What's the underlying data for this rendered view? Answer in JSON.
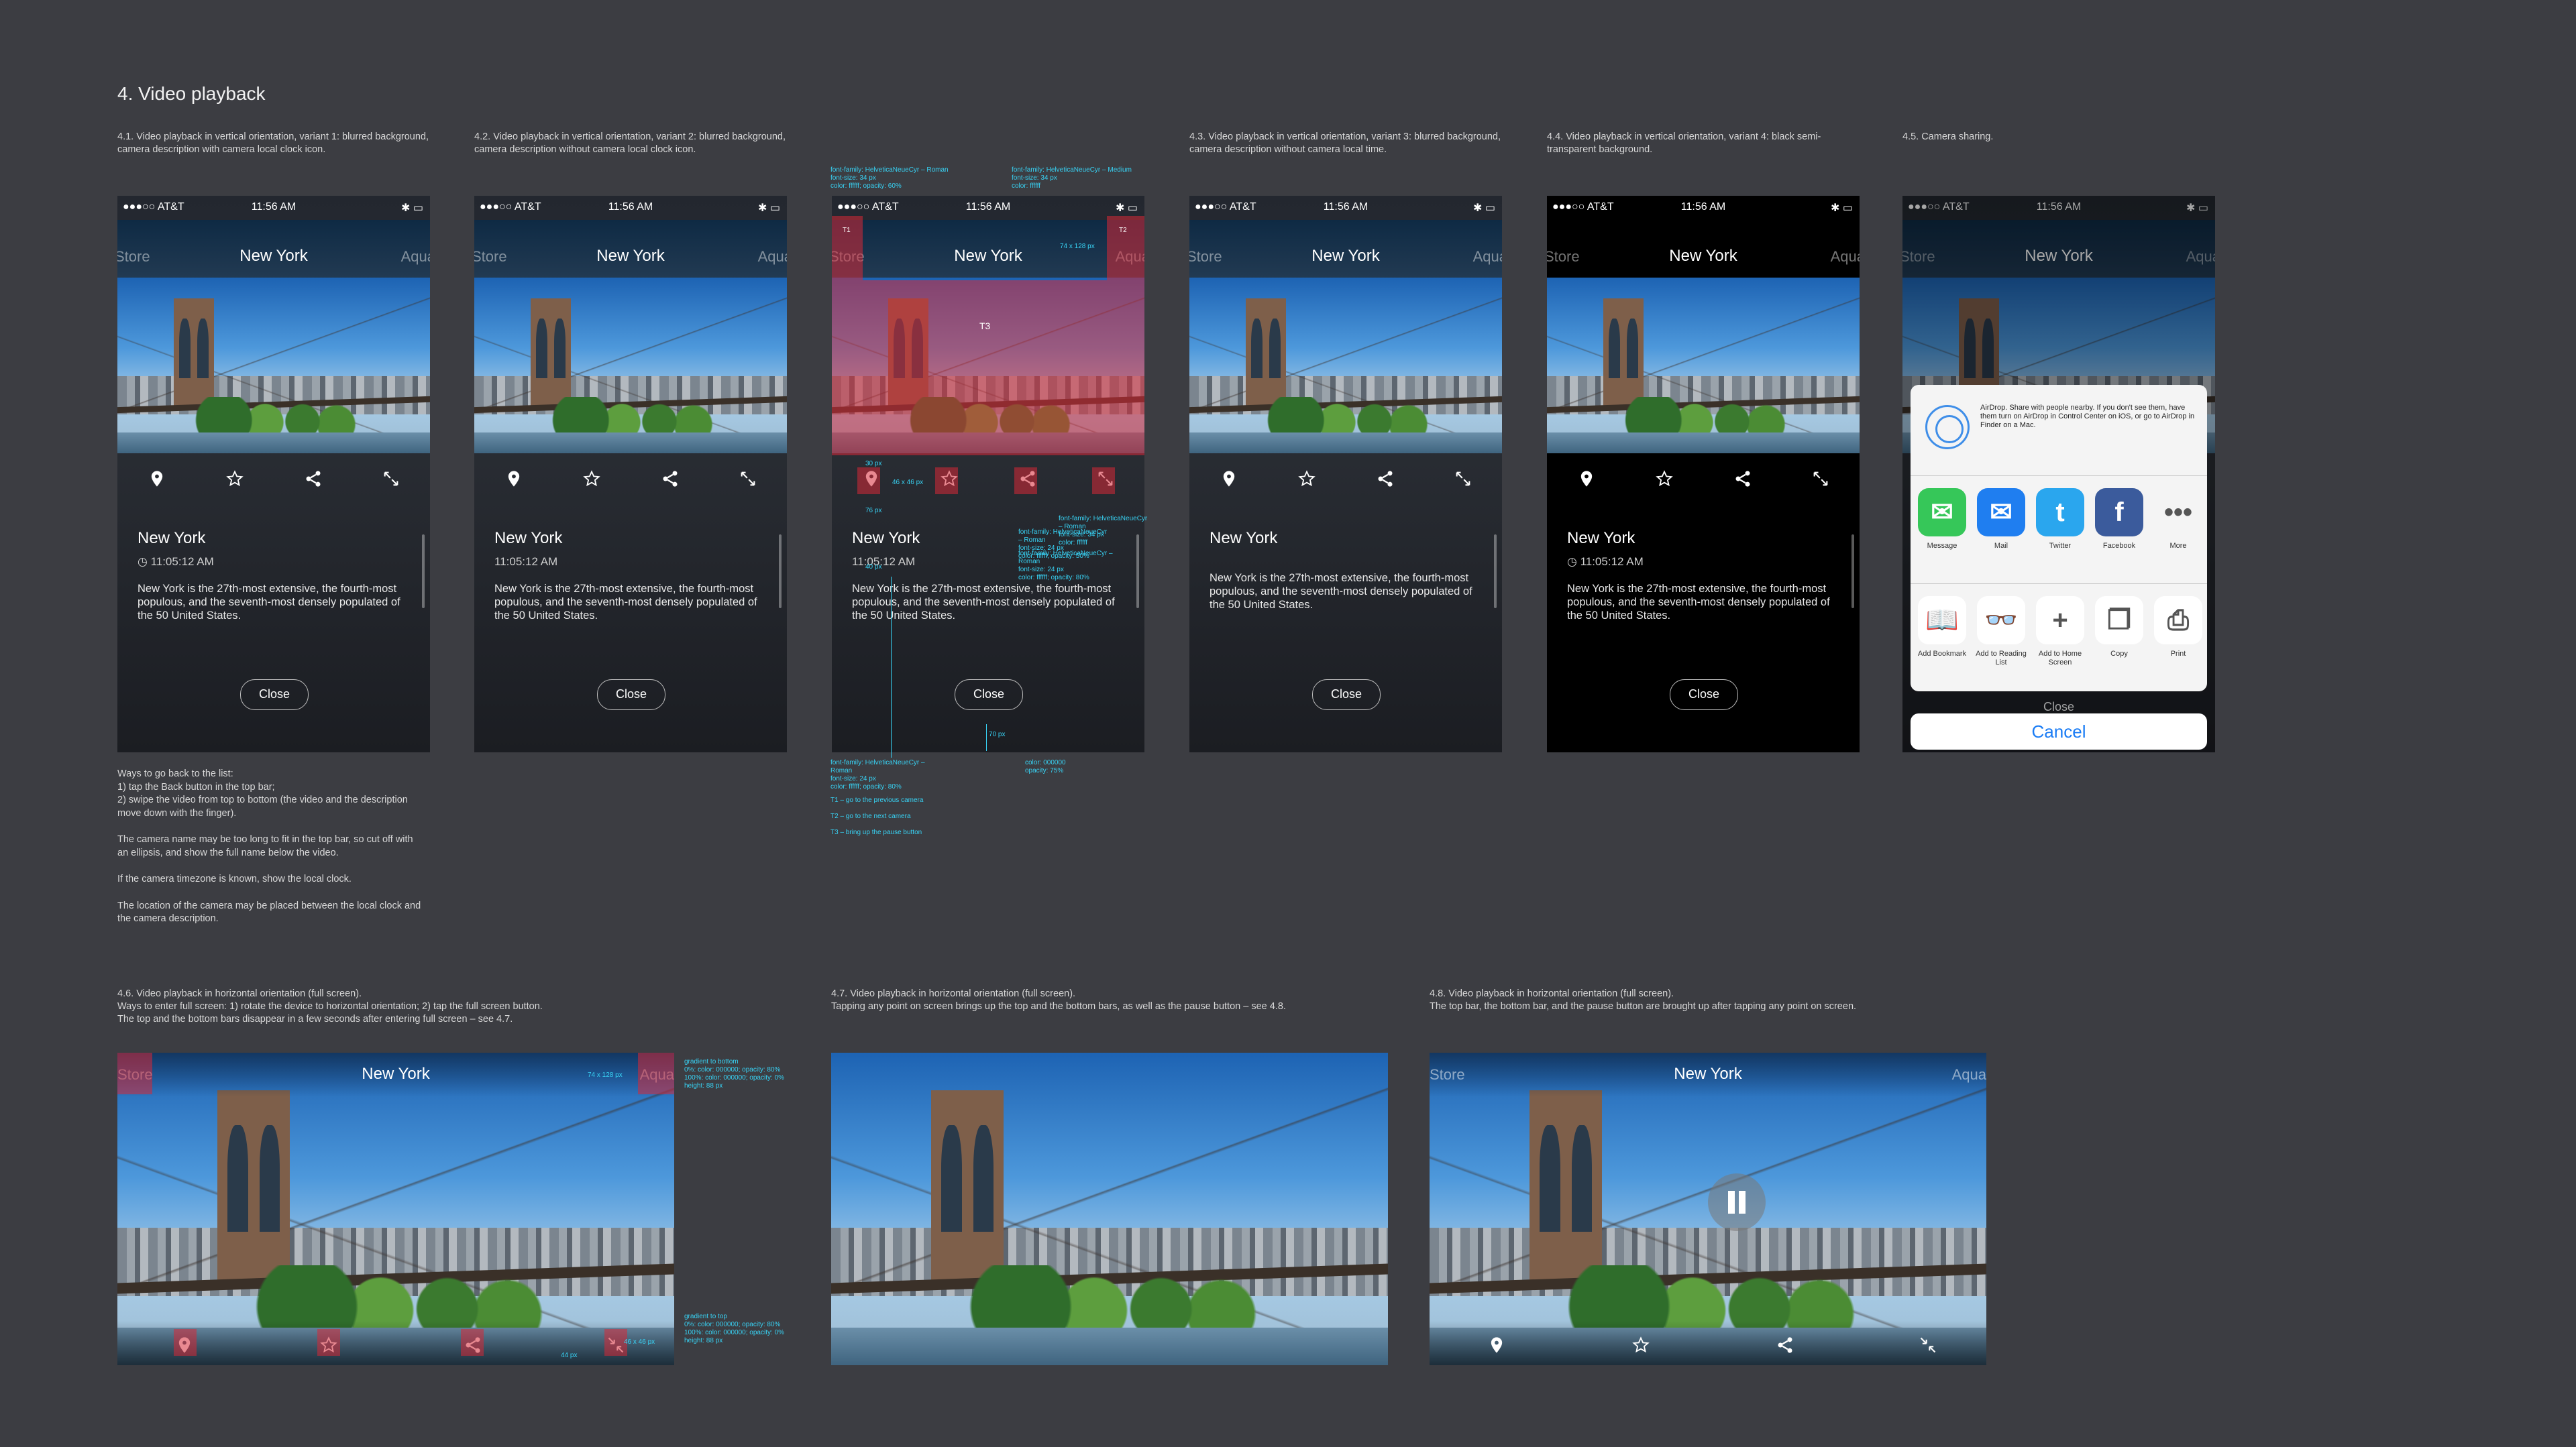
{
  "section_title": "4. Video playback",
  "captions": {
    "c41": "4.1. Video playback in vertical orientation, variant 1: blurred background, camera description with camera local clock icon.",
    "c42": "4.2. Video playback in vertical orientation, variant 2: blurred background, camera description without camera local clock icon.",
    "c43": "4.3. Video playback in vertical orientation, variant 3: blurred background, camera description without camera local time.",
    "c44": "4.4. Video playback in vertical orientation, variant 4: black semi-transparent background.",
    "c45": "4.5. Camera sharing.",
    "c46": "4.6. Video playback in horizontal orientation (full screen).\nWays to enter full screen: 1) rotate the device to horizontal orientation; 2) tap the full screen button.\nThe top and the bottom bars disappear in a few seconds after entering full screen – see 4.7.",
    "c47": "4.7. Video playback in horizontal orientation (full screen).\nTapping any point on screen brings up the top and the bottom bars, as well as the pause button – see 4.8.",
    "c48": "4.8. Video playback in horizontal orientation (full screen).\nThe top bar, the bottom bar, and the pause button are brought up after tapping any point on screen."
  },
  "notes": [
    "Ways to go back to the list:\n1) tap the Back button in the top bar;\n2) swipe the video from top to bottom (the video and the description move down with the finger).",
    "The camera name may be too long to fit in the top bar, so cut off with an ellipsis, and show the full name below the video.",
    "If the camera timezone is known, show the local clock.",
    "The location of the camera may be placed between the local clock and the camera description."
  ],
  "status": {
    "carrier": "●●●○○ AT&T",
    "time": "11:56 AM",
    "battery": "✱ ▭"
  },
  "nav": {
    "title": "New York",
    "prev": "Store",
    "next": "Aqua"
  },
  "camera": {
    "name": "New York",
    "local_time": "11:05:12 AM",
    "description": "New York is the 27th-most extensive, the fourth-most populous, and the seventh-most densely populated of the 50 United States.",
    "close": "Close"
  },
  "specs": {
    "nav_left": "font-family: HelveticaNeueCyr – Roman\nfont-size: 34 px\ncolor: ffffff; opacity: 60%",
    "nav_title": "font-family: HelveticaNeueCyr – Medium\nfont-size: 34 px\ncolor: ffffff",
    "t1": "T1",
    "t2": "T2",
    "t3": "T3",
    "size_74": "74 x 128 px",
    "px30": "30 px",
    "icon_size": "46 x 46 px",
    "px76": "76 px",
    "px40": "40 px",
    "desc_title": "font-family: HelveticaNeueCyr – Roman\nfont-size: 34 px\ncolor: ffffff",
    "desc_time": "font-family: HelveticaNeueCyr – Roman\nfont-size: 24 px\ncolor: ffffff; opacity: 50%",
    "desc_body": "font-family: HelveticaNeueCyr – Roman\nfont-size: 24 px\ncolor: ffffff; opacity: 80%",
    "bg": "color: 000000\nopacity: 75%",
    "px70": "70 px",
    "legend1": "T1 – go to the previous camera",
    "legend2": "T2 – go to the next camera",
    "legend3": "T3 – bring up the pause button",
    "grad_bottom": "gradient to bottom\n  0%: color: 000000; opacity: 80%\n  100%: color: 000000; opacity: 0%\nheight: 88 px",
    "grad_top": "gradient to top\n  0%: color: 000000; opacity: 80%\n  100%: color: 000000; opacity: 0%\nheight: 88 px",
    "px44": "44 px"
  },
  "share": {
    "airdrop": "AirDrop. Share with people nearby. If you don't see them, have them turn on AirDrop in Control Center on iOS, or go to AirDrop in Finder on a Mac.",
    "apps": [
      "Message",
      "Mail",
      "Twitter",
      "Facebook",
      "More"
    ],
    "actions": [
      "Add Bookmark",
      "Add to Reading List",
      "Add to Home Screen",
      "Copy",
      "Print"
    ],
    "cancel": "Cancel",
    "close_behind": "Close"
  },
  "colors": {
    "bg": "#3c3d42",
    "spec": "#38d3f5",
    "accent_red": "#d72837",
    "ios_blue": "#1a7cf5"
  },
  "icons": [
    "location-pin-icon",
    "star-icon",
    "share-icon",
    "fullscreen-icon",
    "exit-fullscreen-icon",
    "clock-icon",
    "pause-icon"
  ]
}
